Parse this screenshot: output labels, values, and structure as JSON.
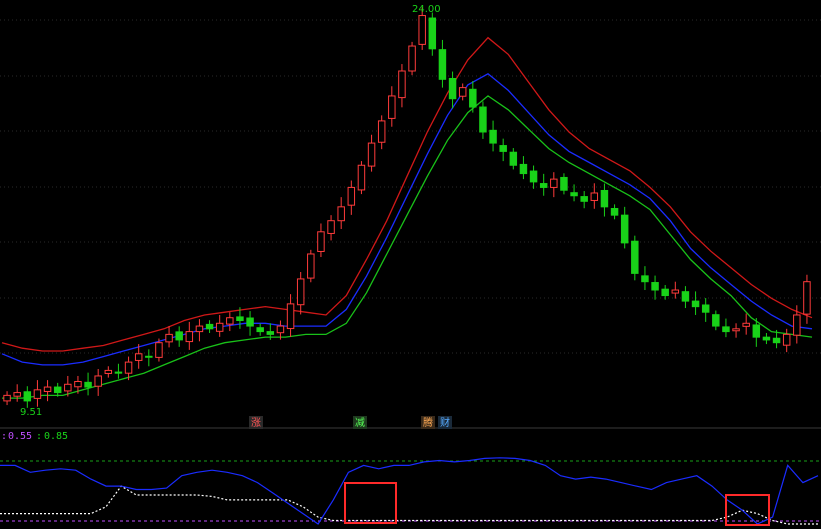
{
  "colors": {
    "background": "#000000",
    "up_candle": "#ff3b3b",
    "down_candle": "#19d219",
    "upper_band": "#d01818",
    "middle_band": "#1a2cff",
    "lower_band": "#19c119",
    "oscillator_line": "#1a2cff",
    "signal_line": "#ffffff",
    "highlight_box": "#ff2a2a",
    "grid": "#2a2a2a"
  },
  "price_labels": {
    "high": "24.00",
    "low": "9.51"
  },
  "indicator_header": {
    "prefix": ":",
    "value1": "0.55",
    "separator": ":",
    "value2": "0.85"
  },
  "markers": [
    {
      "text": "涨",
      "bg": "#2a2a2a",
      "fg": "#ff5555"
    },
    {
      "text": "减",
      "bg": "#1f3a1f",
      "fg": "#55ff55"
    },
    {
      "text": "腾",
      "bg": "#3a2a1a",
      "fg": "#ffaa55"
    },
    {
      "text": "财",
      "bg": "#1a2a3a",
      "fg": "#55aaff"
    }
  ],
  "chart_data": {
    "type": "line",
    "panels": [
      {
        "name": "price",
        "y_range": [
          9.5,
          24.0
        ],
        "candles_close": [
          10.1,
          10.2,
          9.9,
          10.3,
          10.4,
          10.2,
          10.5,
          10.6,
          10.4,
          10.8,
          11.0,
          10.9,
          11.3,
          11.6,
          11.5,
          12.0,
          12.3,
          12.1,
          12.4,
          12.6,
          12.5,
          12.7,
          12.9,
          12.8,
          12.6,
          12.4,
          12.3,
          12.6,
          13.4,
          14.3,
          15.2,
          16.0,
          16.4,
          16.9,
          17.6,
          18.4,
          19.2,
          20.0,
          20.9,
          21.8,
          22.7,
          23.8,
          22.6,
          21.5,
          20.8,
          21.2,
          20.5,
          19.6,
          19.2,
          18.9,
          18.4,
          18.1,
          17.8,
          17.6,
          17.9,
          17.5,
          17.3,
          17.1,
          17.4,
          16.9,
          16.6,
          15.6,
          14.5,
          14.2,
          13.9,
          13.7,
          13.9,
          13.5,
          13.3,
          13.1,
          12.6,
          12.4,
          12.5,
          12.7,
          12.2,
          12.1,
          12.0,
          12.3,
          13.0,
          14.2
        ],
        "upper_band": [
          12.0,
          11.8,
          11.7,
          11.7,
          11.8,
          11.9,
          12.1,
          12.3,
          12.5,
          12.8,
          13.0,
          13.1,
          13.2,
          13.3,
          13.2,
          13.1,
          13.0,
          13.7,
          15.0,
          16.4,
          18.0,
          19.6,
          21.0,
          22.2,
          23.0,
          22.4,
          21.4,
          20.4,
          19.6,
          19.0,
          18.6,
          18.2,
          17.6,
          16.9,
          16.0,
          15.3,
          14.7,
          14.1,
          13.6,
          13.2,
          12.9
        ],
        "middle_band": [
          11.6,
          11.3,
          11.2,
          11.2,
          11.3,
          11.5,
          11.7,
          11.9,
          12.1,
          12.3,
          12.5,
          12.6,
          12.7,
          12.7,
          12.6,
          12.6,
          12.6,
          13.2,
          14.4,
          15.8,
          17.3,
          18.8,
          20.2,
          21.3,
          21.7,
          21.1,
          20.3,
          19.5,
          18.9,
          18.5,
          18.1,
          17.7,
          17.2,
          16.4,
          15.4,
          14.7,
          14.1,
          13.5,
          13.0,
          12.6,
          12.5
        ],
        "lower_band": [
          10.0,
          10.0,
          10.1,
          10.1,
          10.3,
          10.5,
          10.7,
          10.9,
          11.2,
          11.5,
          11.8,
          12.0,
          12.1,
          12.2,
          12.2,
          12.3,
          12.3,
          12.7,
          13.8,
          15.2,
          16.6,
          18.0,
          19.3,
          20.3,
          20.9,
          20.4,
          19.7,
          19.0,
          18.5,
          18.1,
          17.7,
          17.3,
          16.8,
          15.9,
          15.0,
          14.3,
          13.7,
          12.9,
          12.4,
          12.3,
          12.2
        ]
      },
      {
        "name": "oscillator",
        "y_range": [
          0,
          1
        ],
        "reference_levels": [
          0.85,
          0.55
        ],
        "oscillator": [
          0.85,
          0.85,
          0.75,
          0.78,
          0.8,
          0.78,
          0.65,
          0.55,
          0.55,
          0.5,
          0.5,
          0.52,
          0.7,
          0.75,
          0.78,
          0.75,
          0.7,
          0.6,
          0.45,
          0.3,
          0.15,
          0.0,
          0.35,
          0.75,
          0.85,
          0.8,
          0.85,
          0.85,
          0.9,
          0.92,
          0.9,
          0.92,
          0.95,
          0.96,
          0.95,
          0.92,
          0.85,
          0.7,
          0.65,
          0.68,
          0.65,
          0.6,
          0.55,
          0.5,
          0.6,
          0.65,
          0.7,
          0.55,
          0.35,
          0.2,
          0.0,
          0.1,
          0.85,
          0.6,
          0.7
        ],
        "signal": [
          0.15,
          0.15,
          0.15,
          0.15,
          0.15,
          0.15,
          0.15,
          0.25,
          0.55,
          0.42,
          0.42,
          0.42,
          0.42,
          0.42,
          0.4,
          0.35,
          0.35,
          0.35,
          0.35,
          0.35,
          0.25,
          0.1,
          0.05,
          0.05,
          0.05,
          0.05,
          0.05,
          0.05,
          0.05,
          0.05,
          0.05,
          0.05,
          0.05,
          0.05,
          0.05,
          0.05,
          0.05,
          0.05,
          0.05,
          0.05,
          0.05,
          0.05,
          0.05,
          0.05,
          0.05,
          0.05,
          0.05,
          0.05,
          0.1,
          0.2,
          0.15,
          0.05,
          0.0,
          0.0,
          0.0
        ]
      }
    ]
  }
}
